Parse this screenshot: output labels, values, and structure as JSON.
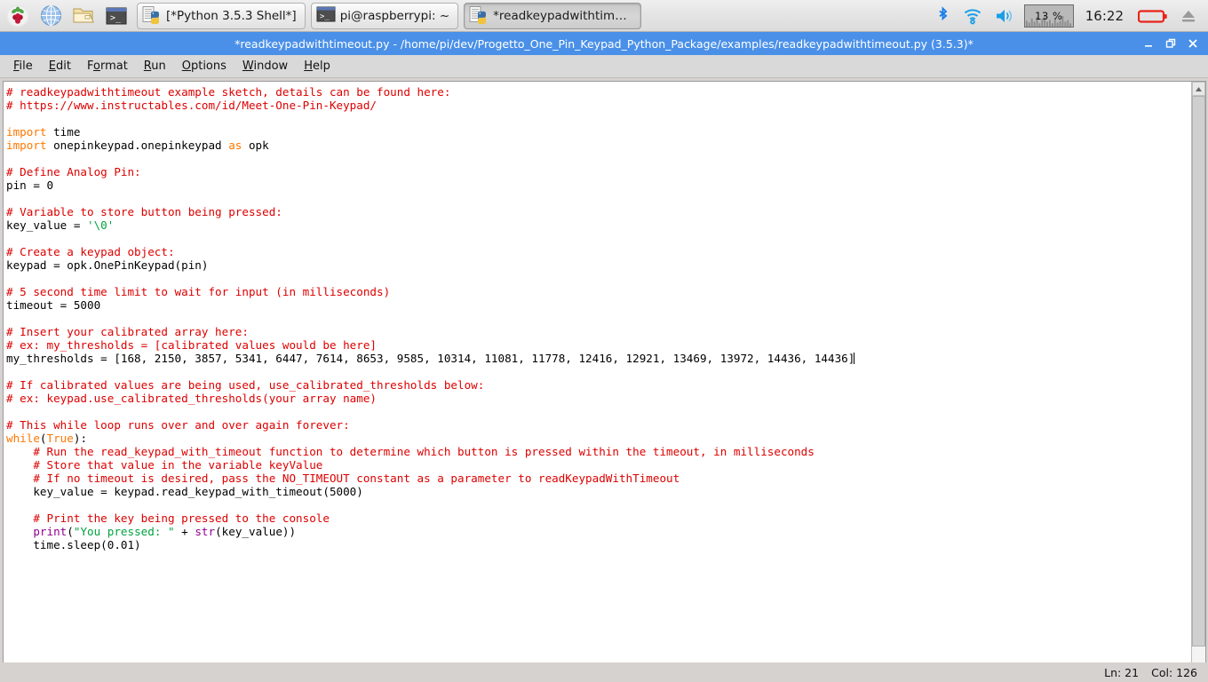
{
  "taskbar": {
    "launchers": [
      {
        "name": "raspberry-menu-icon",
        "label": "Menu"
      },
      {
        "name": "web-browser-icon",
        "label": "Web Browser"
      },
      {
        "name": "file-manager-icon",
        "label": "File Manager"
      },
      {
        "name": "terminal-icon",
        "label": "Terminal"
      }
    ],
    "windows": [
      {
        "name": "window-button-python-shell",
        "label": "[*Python 3.5.3 Shell*]",
        "icon": "python-icon",
        "active": false
      },
      {
        "name": "window-button-terminal",
        "label": "pi@raspberrypi: ~",
        "icon": "terminal-icon",
        "active": false
      },
      {
        "name": "window-button-editor",
        "label": "*readkeypadwithtime…",
        "icon": "python-icon",
        "active": true
      }
    ],
    "tray": {
      "bluetooth_icon": "bluetooth-icon",
      "wifi_icon": "wifi-icon",
      "volume_icon": "volume-icon",
      "cpu_label": "13 %",
      "clock": "16:22",
      "battery_icon": "battery-icon",
      "eject_icon": "eject-icon"
    }
  },
  "window": {
    "title": "*readkeypadwithtimeout.py - /home/pi/dev/Progetto_One_Pin_Keypad_Python_Package/examples/readkeypadwithtimeout.py (3.5.3)*",
    "buttons": {
      "minimize": "minimize-button",
      "maximize": "maximize-button",
      "close": "close-button"
    },
    "menu": [
      "File",
      "Edit",
      "Format",
      "Run",
      "Options",
      "Window",
      "Help"
    ]
  },
  "editor": {
    "lines": [
      [
        {
          "t": "# readkeypadwithtimeout example sketch, details can be found here:",
          "c": "cm"
        }
      ],
      [
        {
          "t": "# https://www.instructables.com/id/Meet-One-Pin-Keypad/",
          "c": "cm"
        }
      ],
      [],
      [
        {
          "t": "import",
          "c": "kw"
        },
        {
          "t": " time",
          "c": ""
        }
      ],
      [
        {
          "t": "import",
          "c": "kw"
        },
        {
          "t": " onepinkeypad.onepinkeypad ",
          "c": ""
        },
        {
          "t": "as",
          "c": "kw"
        },
        {
          "t": " opk",
          "c": ""
        }
      ],
      [],
      [
        {
          "t": "# Define Analog Pin:",
          "c": "cm"
        }
      ],
      [
        {
          "t": "pin = 0",
          "c": ""
        }
      ],
      [],
      [
        {
          "t": "# Variable to store button being pressed:",
          "c": "cm"
        }
      ],
      [
        {
          "t": "key_value = ",
          "c": ""
        },
        {
          "t": "'\\0'",
          "c": "st"
        }
      ],
      [],
      [
        {
          "t": "# Create a keypad object:",
          "c": "cm"
        }
      ],
      [
        {
          "t": "keypad = opk.OnePinKeypad(pin)",
          "c": ""
        }
      ],
      [],
      [
        {
          "t": "# 5 second time limit to wait for input (in milliseconds)",
          "c": "cm"
        }
      ],
      [
        {
          "t": "timeout = 5000",
          "c": ""
        }
      ],
      [],
      [
        {
          "t": "# Insert your calibrated array here:",
          "c": "cm"
        }
      ],
      [
        {
          "t": "# ex: my_thresholds = [calibrated values would be here]",
          "c": "cm"
        }
      ],
      [
        {
          "t": "my_thresholds = [168, 2150, 3857, 5341, 6447, 7614, 8653, 9585, 10314, 11081, 11778, 12416, 12921, 13469, 13972, 14436, 14436]",
          "c": "",
          "cursor": true
        }
      ],
      [],
      [
        {
          "t": "# If calibrated values are being used, use_calibrated_thresholds below:",
          "c": "cm"
        }
      ],
      [
        {
          "t": "# ex: keypad.use_calibrated_thresholds(your array name)",
          "c": "cm"
        }
      ],
      [],
      [
        {
          "t": "# This while loop runs over and over again forever:",
          "c": "cm"
        }
      ],
      [
        {
          "t": "while",
          "c": "kw"
        },
        {
          "t": "(",
          "c": ""
        },
        {
          "t": "True",
          "c": "kw"
        },
        {
          "t": "):",
          "c": ""
        }
      ],
      [
        {
          "t": "    # Run the read_keypad_with_timeout function to determine which button is pressed within the timeout, in milliseconds",
          "c": "cm"
        }
      ],
      [
        {
          "t": "    # Store that value in the variable keyValue",
          "c": "cm"
        }
      ],
      [
        {
          "t": "    # If no timeout is desired, pass the NO_TIMEOUT constant as a parameter to readKeypadWithTimeout",
          "c": "cm"
        }
      ],
      [
        {
          "t": "    key_value = keypad.read_keypad_with_timeout(5000)",
          "c": ""
        }
      ],
      [],
      [
        {
          "t": "    # Print the key being pressed to the console",
          "c": "cm"
        }
      ],
      [
        {
          "t": "    ",
          "c": ""
        },
        {
          "t": "print",
          "c": "bi"
        },
        {
          "t": "(",
          "c": ""
        },
        {
          "t": "\"You pressed: \"",
          "c": "st"
        },
        {
          "t": " + ",
          "c": ""
        },
        {
          "t": "str",
          "c": "bi"
        },
        {
          "t": "(key_value))",
          "c": ""
        }
      ],
      [
        {
          "t": "    time.sleep(0.01)",
          "c": ""
        }
      ]
    ]
  },
  "statusbar": {
    "line_label": "Ln: 21",
    "col_label": "Col: 126"
  },
  "colors": {
    "titlebar": "#4a90e8",
    "comment": "#dd0000",
    "keyword": "#ff7700",
    "string": "#00a33f",
    "builtin": "#900090",
    "chrome": "#d6d2d0"
  }
}
